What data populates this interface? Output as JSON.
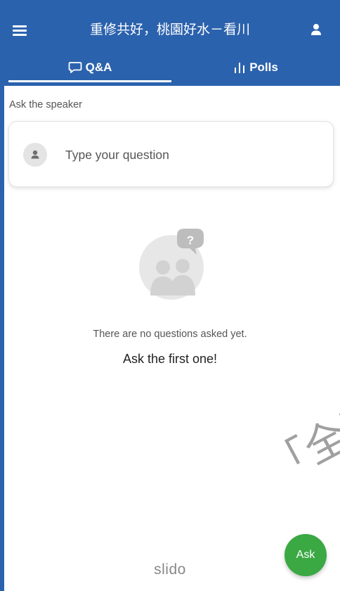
{
  "header": {
    "title": "重修共好，桃園好水－看川",
    "menu_icon": "hamburger-menu-icon",
    "user_icon": "user-icon",
    "color": "#2b62ad"
  },
  "tabs": [
    {
      "label": "Q&A",
      "icon": "chat-bubble-icon",
      "active": true
    },
    {
      "label": "Polls",
      "icon": "bar-chart-icon",
      "active": false
    }
  ],
  "qa": {
    "section_label": "Ask the speaker",
    "input_placeholder": "Type your question",
    "empty_message": "There are no questions asked yet.",
    "empty_cta": "Ask the first one!"
  },
  "watermark": "「全国",
  "footer": {
    "logo": "slido"
  },
  "fab": {
    "label": "Ask",
    "color": "#3aa843"
  }
}
